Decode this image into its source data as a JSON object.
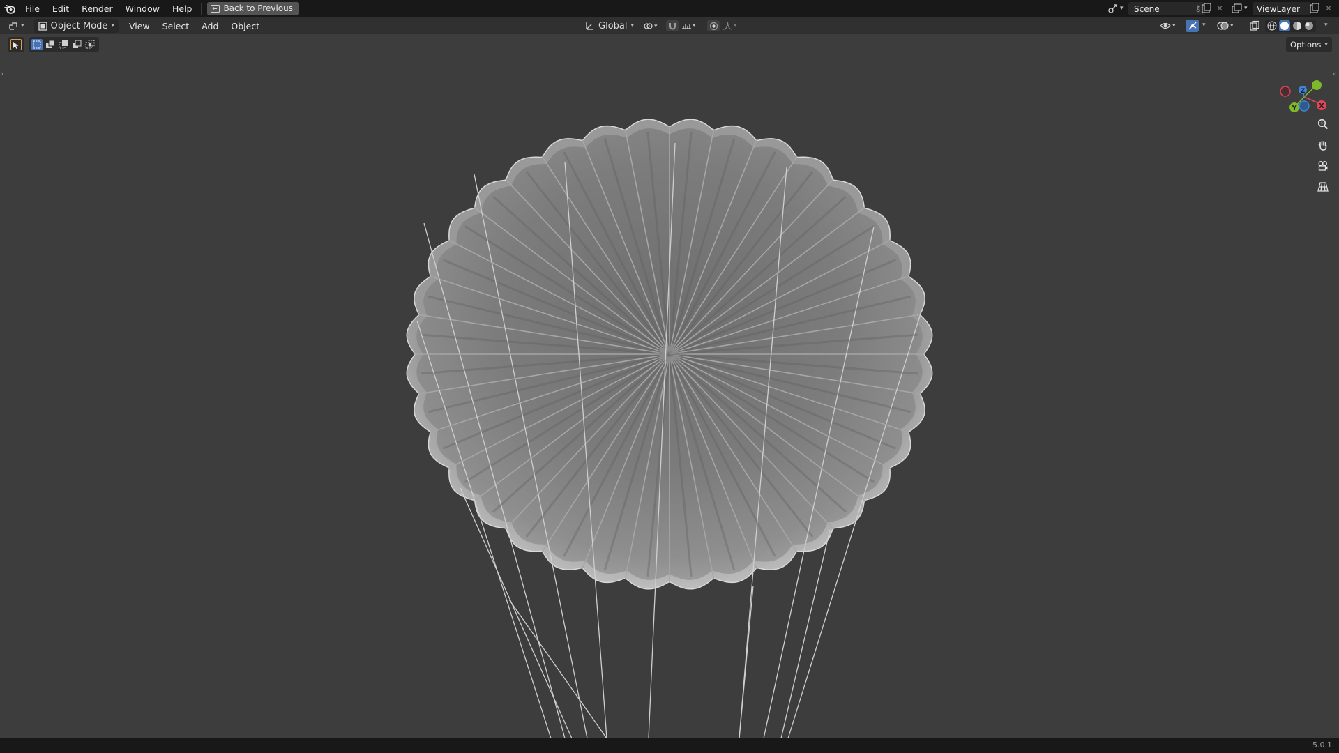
{
  "menubar": {
    "items": [
      "File",
      "Edit",
      "Render",
      "Window",
      "Help"
    ],
    "back_button": "Back to Previous",
    "scene_name": "Scene",
    "view_layer": "ViewLayer"
  },
  "viewport_header": {
    "mode": "Object Mode",
    "menus": [
      "View",
      "Select",
      "Add",
      "Object"
    ],
    "transform_orientation": "Global"
  },
  "viewport": {
    "options_label": "Options",
    "gizmo": {
      "x_label": "X",
      "y_label": "Y",
      "z_label": "Z"
    }
  },
  "statusbar": {
    "version": "5.0.1"
  },
  "colors": {
    "axis_x": "#e0455a",
    "axis_y": "#7fb82a",
    "axis_z": "#3f86d8",
    "active_tool": "#4772b3",
    "snap_active": "#4772b3"
  }
}
